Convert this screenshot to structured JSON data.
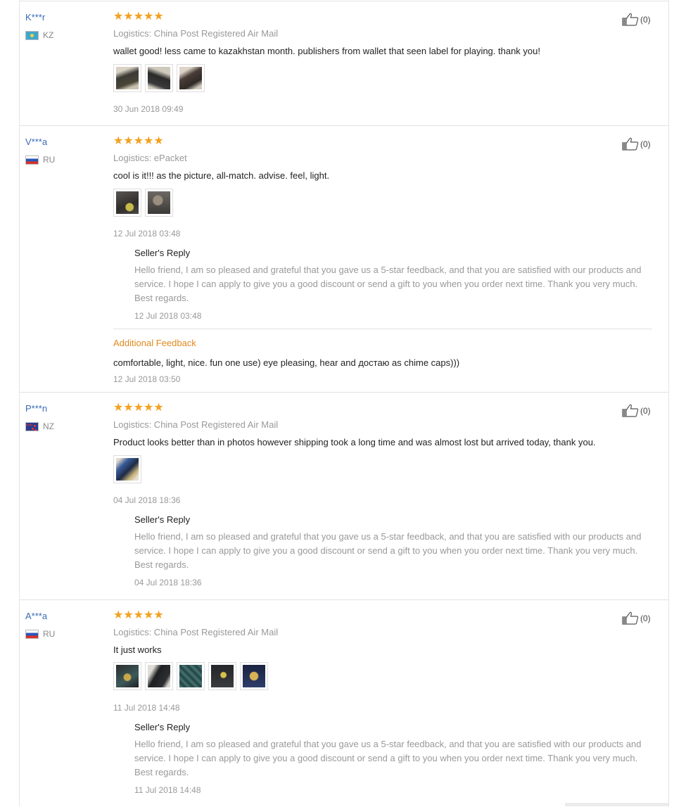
{
  "reviews": [
    {
      "user": "K***r",
      "country": "KZ",
      "stars": "★★★★★",
      "logistics": "Logistics: China Post Registered Air Mail",
      "comment": "wallet good! less came to kazakhstan month. publishers from wallet that seen label for playing. thank you!",
      "date": "30 Jun 2018 09:49",
      "likes": "(0)",
      "photo_count": 3
    },
    {
      "user": "V***a",
      "country": "RU",
      "stars": "★★★★★",
      "logistics": "Logistics: ePacket",
      "comment": "cool is it!!! as the picture, all-match. advise. feel, light.",
      "date": "12 Jul 2018 03:48",
      "likes": "(0)",
      "photo_count": 2,
      "reply_title": "Seller's Reply",
      "reply_text": "Hello friend, I am so pleased and grateful that you gave us a 5-star feedback, and that you are satisfied with our products and service. I hope I can apply to give you a good discount or send a gift to you when you order next time. Thank you very much. Best regards.",
      "reply_date": "12 Jul 2018 03:48",
      "additional_title": "Additional Feedback",
      "additional_text": "comfortable, light, nice. fun one use) eye pleasing, hear and достаю as chime caps)))",
      "additional_date": "12 Jul 2018 03:50"
    },
    {
      "user": "P***n",
      "country": "NZ",
      "stars": "★★★★★",
      "logistics": "Logistics: China Post Registered Air Mail",
      "comment": "Product looks better than in photos however shipping took a long time and was almost lost but arrived today, thank you.",
      "date": "04 Jul 2018 18:36",
      "likes": "(0)",
      "photo_count": 1,
      "reply_title": "Seller's Reply",
      "reply_text": "Hello friend, I am so pleased and grateful that you gave us a 5-star feedback, and that you are satisfied with our products and service. I hope I can apply to give you a good discount or send a gift to you when you order next time. Thank you very much. Best regards.",
      "reply_date": "04 Jul 2018 18:36"
    },
    {
      "user": "A***a",
      "country": "RU",
      "stars": "★★★★★",
      "logistics": "Logistics: China Post Registered Air Mail",
      "comment": "It just works",
      "date": "11 Jul 2018 14:48",
      "likes": "(0)",
      "photo_count": 5,
      "reply_title": "Seller's Reply",
      "reply_text": "Hello friend, I am so pleased and grateful that you gave us a 5-star feedback, and that you are satisfied with our products and service. I hope I can apply to give you a good discount or send a gift to you when you order next time. Thank you very much. Best regards.",
      "reply_date": "11 Jul 2018 14:48"
    }
  ],
  "icons": {
    "like": "thumbs-up-icon",
    "star": "star-icon"
  },
  "colors": {
    "user_link": "#3a6bb7",
    "stars": "#f2a120",
    "additional_feedback": "#e08a1e"
  }
}
